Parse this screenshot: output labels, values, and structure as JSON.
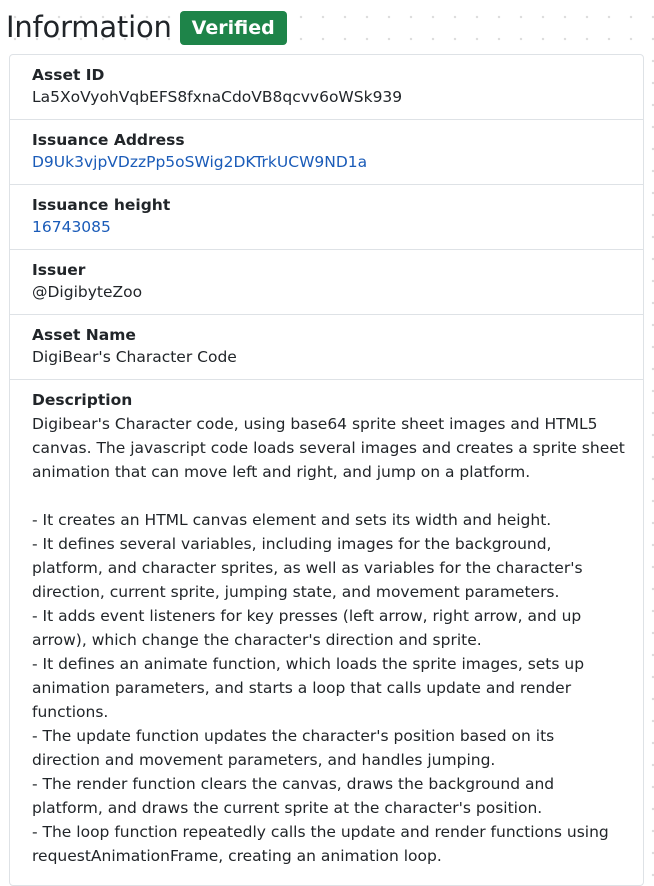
{
  "header": {
    "title": "Information",
    "badge": "Verified"
  },
  "fields": {
    "asset_id": {
      "label": "Asset ID",
      "value": "La5XoVyohVqbEFS8fxnaCdoVB8qcvv6oWSk939"
    },
    "issuance_address": {
      "label": "Issuance Address",
      "value": "D9Uk3vjpVDzzPp5oSWig2DKTrkUCW9ND1a"
    },
    "issuance_height": {
      "label": "Issuance height",
      "value": "16743085"
    },
    "issuer": {
      "label": "Issuer",
      "value": "@DigibyteZoo"
    },
    "asset_name": {
      "label": "Asset Name",
      "value": "DigiBear's Character Code"
    },
    "description": {
      "label": "Description",
      "value": "Digibear's Character code, using base64 sprite sheet images and HTML5 canvas. The javascript code loads several images and creates a sprite sheet animation that can move left and right, and jump on a platform.\n\n- It creates an HTML canvas element and sets its width and height.\n- It defines several variables, including images for the background, platform, and character sprites, as well as variables for the character's direction, current sprite, jumping state, and movement parameters.\n- It adds event listeners for key presses (left arrow, right arrow, and up arrow), which change the character's direction and sprite.\n- It defines an animate function, which loads the sprite images, sets up animation parameters, and starts a loop that calls update and render functions.\n- The update function updates the character's position based on its direction and movement parameters, and handles jumping.\n- The render function clears the canvas, draws the background and platform, and draws the current sprite at the character's position.\n- The loop function repeatedly calls the update and render functions using requestAnimationFrame, creating an animation loop."
    }
  },
  "colors": {
    "badge_bg": "#1e8449",
    "link": "#1a5bb8",
    "border": "#dee2e6"
  }
}
